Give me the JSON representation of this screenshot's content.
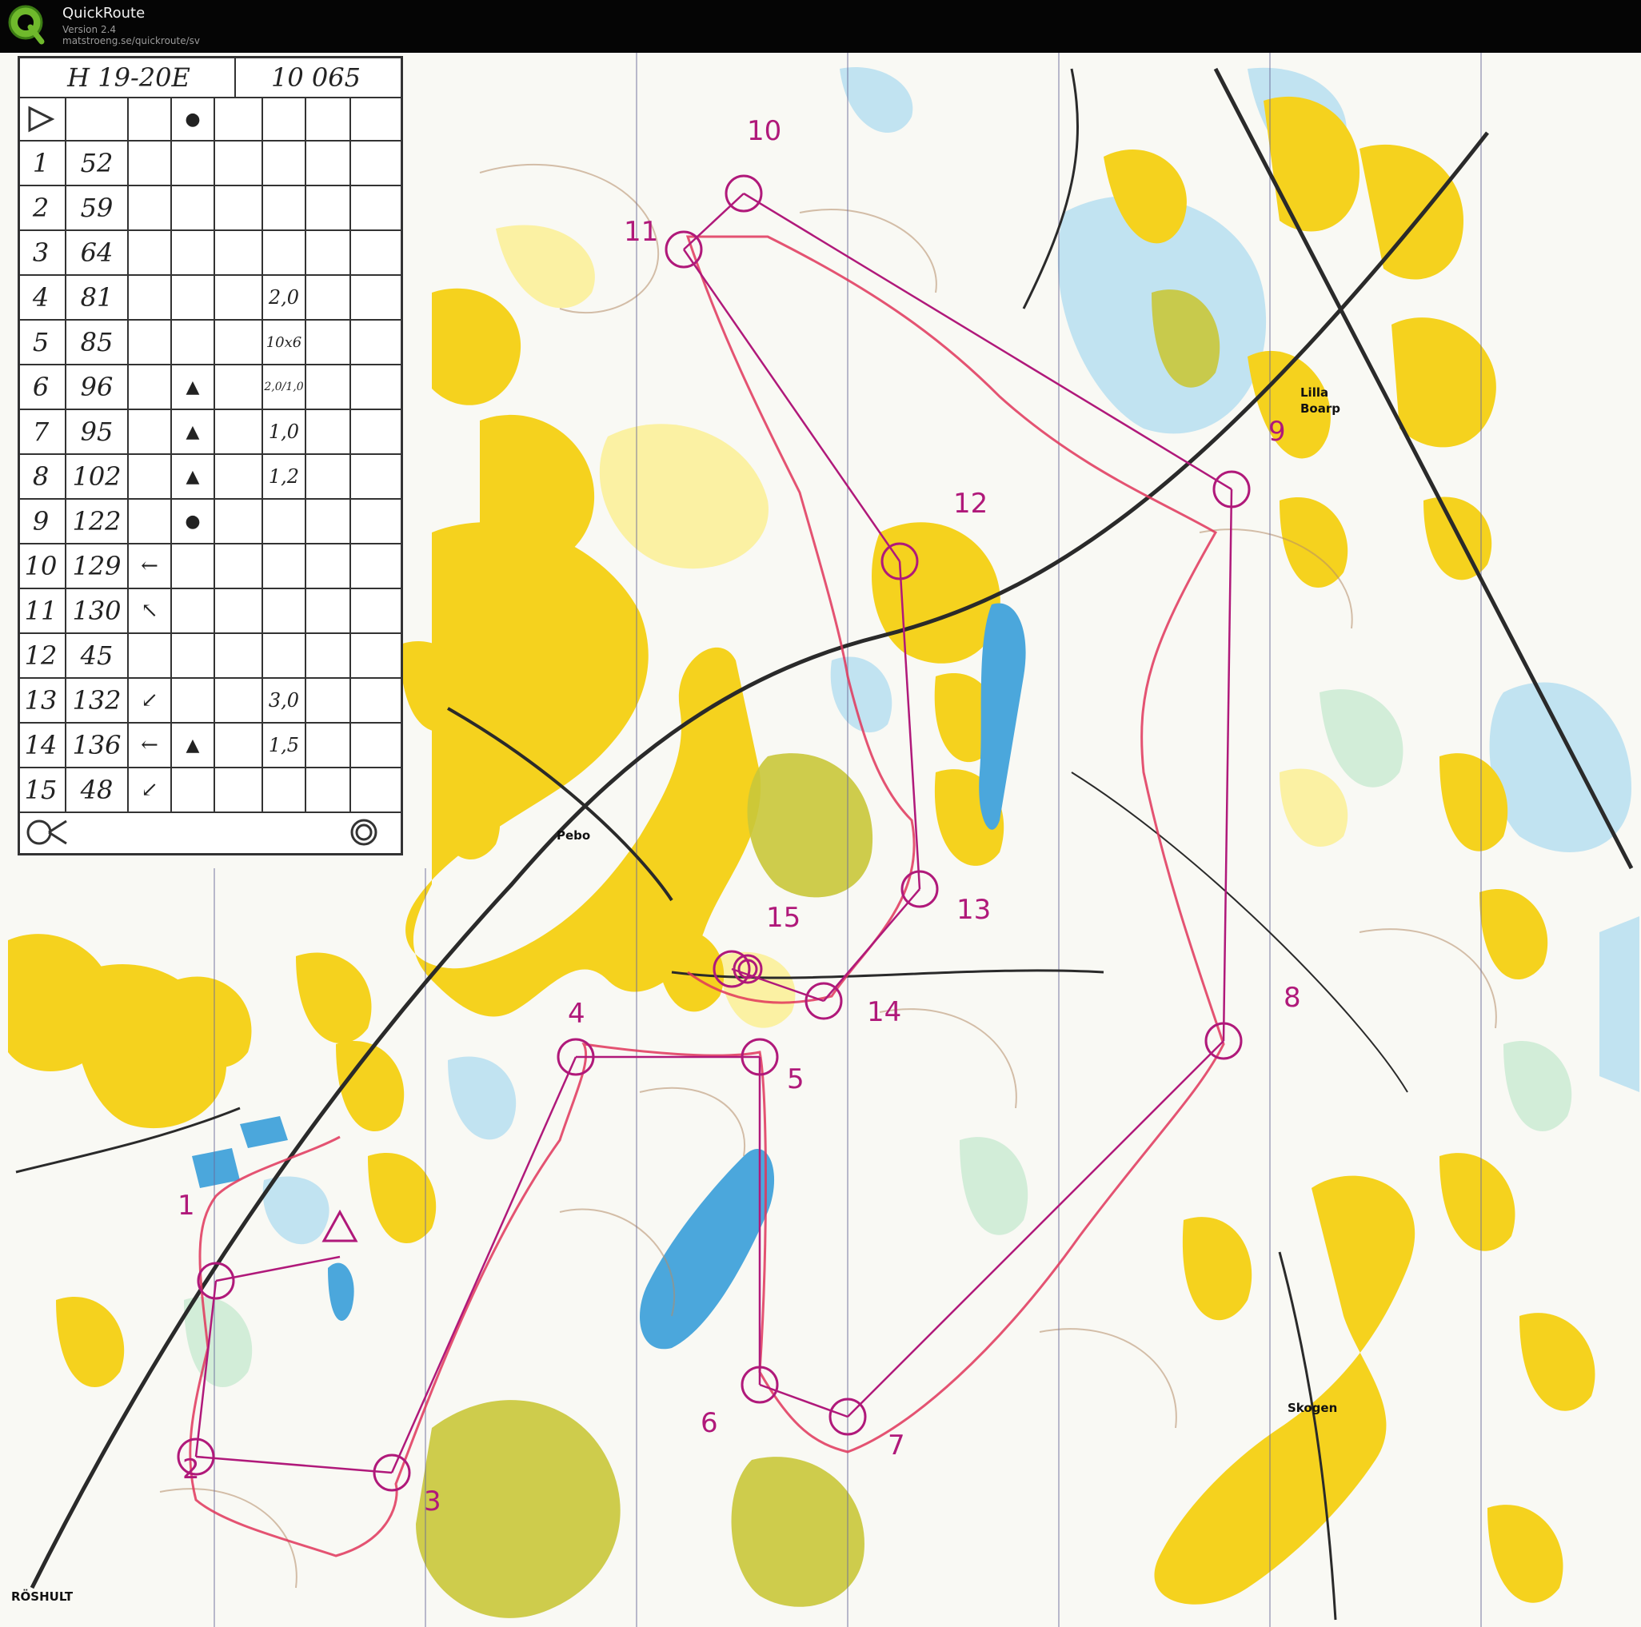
{
  "window": {
    "title": "QuickRoute",
    "version": "Version 2.4",
    "url": "matstroeng.se/quickroute/sv"
  },
  "description_sheet": {
    "class": "H 19-20E",
    "length": "10 065",
    "rows": [
      {
        "no": "1",
        "code": "52"
      },
      {
        "no": "2",
        "code": "59"
      },
      {
        "no": "3",
        "code": "64"
      },
      {
        "no": "4",
        "code": "81",
        "dim": "2,0"
      },
      {
        "no": "5",
        "code": "85",
        "dim": "10x6"
      },
      {
        "no": "6",
        "code": "96",
        "dim": "2,0/1,0"
      },
      {
        "no": "7",
        "code": "95",
        "dim": "1,0"
      },
      {
        "no": "8",
        "code": "102",
        "dim": "1,2"
      },
      {
        "no": "9",
        "code": "122"
      },
      {
        "no": "10",
        "code": "129"
      },
      {
        "no": "11",
        "code": "130"
      },
      {
        "no": "12",
        "code": "45"
      },
      {
        "no": "13",
        "code": "132",
        "dim": "3,0"
      },
      {
        "no": "14",
        "code": "136",
        "dim": "1,5"
      },
      {
        "no": "15",
        "code": "48"
      }
    ]
  },
  "place_names": {
    "lilla_boarp_1": "Lilla",
    "lilla_boarp_2": "Boarp",
    "pebo": "Pebo",
    "skogen": "Skogen",
    "roshult": "RÖSHULT"
  },
  "controls": [
    {
      "label": "1"
    },
    {
      "label": "2"
    },
    {
      "label": "3"
    },
    {
      "label": "4"
    },
    {
      "label": "5"
    },
    {
      "label": "6"
    },
    {
      "label": "7"
    },
    {
      "label": "8"
    },
    {
      "label": "9"
    },
    {
      "label": "10"
    },
    {
      "label": "11"
    },
    {
      "label": "12"
    },
    {
      "label": "13"
    },
    {
      "label": "14"
    },
    {
      "label": "15"
    }
  ],
  "colors": {
    "course": "#b0197a",
    "route": "#e0365a",
    "open_land": "#f5d21e",
    "rough_open": "#fbef9a",
    "marsh": "#b7dff0",
    "water": "#4ba7dc",
    "green": "#cdebd5",
    "olive": "#c9c73a"
  }
}
